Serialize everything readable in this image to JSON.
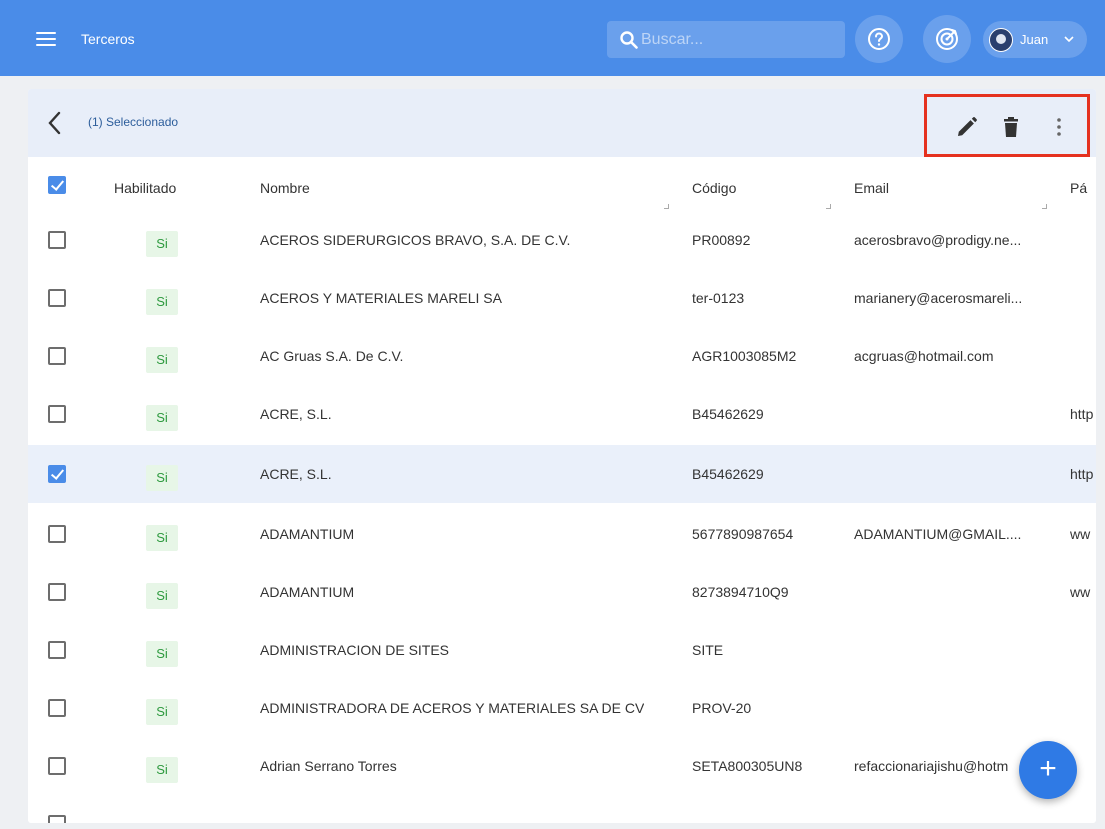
{
  "topbar": {
    "title": "Terceros",
    "search_placeholder": "Buscar...",
    "user_name": "Juan",
    "accent": "#4a8ce8"
  },
  "selection": {
    "label": "(1) Seleccionado",
    "actions": [
      "pencil-icon",
      "trash-icon",
      "more-vert-icon"
    ]
  },
  "columns": {
    "enabled": "Habilitado",
    "name": "Nombre",
    "code": "Código",
    "email": "Email",
    "page": "Pá"
  },
  "rows": [
    {
      "checked": false,
      "enabled": "Si",
      "name": "ACEROS SIDERURGICOS BRAVO, S.A. DE C.V.",
      "code": "PR00892",
      "email": "acerosbravo@prodigy.ne...",
      "page": ""
    },
    {
      "checked": false,
      "enabled": "Si",
      "name": "ACEROS Y MATERIALES MARELI SA",
      "code": "ter-0123",
      "email": "marianery@acerosmareli...",
      "page": ""
    },
    {
      "checked": false,
      "enabled": "Si",
      "name": "AC Gruas S.A. De C.V.",
      "code": "AGR1003085M2",
      "email": "acgruas@hotmail.com",
      "page": ""
    },
    {
      "checked": false,
      "enabled": "Si",
      "name": "ACRE, S.L.",
      "code": "B45462629",
      "email": "",
      "page": "http"
    },
    {
      "checked": true,
      "enabled": "Si",
      "name": "ACRE, S.L.",
      "code": "B45462629",
      "email": "",
      "page": "http"
    },
    {
      "checked": false,
      "enabled": "Si",
      "name": "ADAMANTIUM",
      "code": "5677890987654",
      "email": "ADAMANTIUM@GMAIL....",
      "page": "ww"
    },
    {
      "checked": false,
      "enabled": "Si",
      "name": "ADAMANTIUM",
      "code": "8273894710Q9",
      "email": "",
      "page": "ww"
    },
    {
      "checked": false,
      "enabled": "Si",
      "name": "ADMINISTRACION DE SITES",
      "code": "SITE",
      "email": "",
      "page": ""
    },
    {
      "checked": false,
      "enabled": "Si",
      "name": "ADMINISTRADORA DE ACEROS Y MATERIALES SA DE CV",
      "code": "PROV-20",
      "email": "",
      "page": ""
    },
    {
      "checked": false,
      "enabled": "Si",
      "name": "Adrian Serrano Torres",
      "code": "SETA800305UN8",
      "email": "refaccionariajishu@hotm",
      "page": ""
    }
  ],
  "fab_label": "+"
}
